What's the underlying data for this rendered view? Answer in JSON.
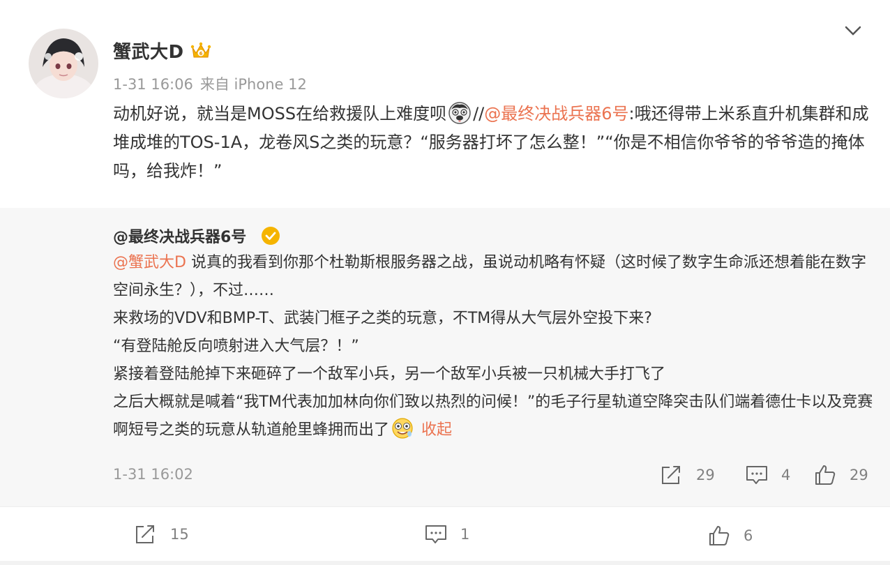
{
  "post": {
    "author": "蟹武大D",
    "time": "1-31 16:06",
    "source": "来自 iPhone 12",
    "text_1": "动机好说，就当是MOSS在给救援队上难度呗",
    "text_sep": "//",
    "mention": "@最终决战兵器6号",
    "text_2": ":哦还得带上米系直升机集群和成堆成堆的TOS-1A，龙卷风S之类的玩意？“服务器打坏了怎么整！”“你是不相信你爷爷的爷爷造的掩体吗，给我炸！”"
  },
  "repost": {
    "author": "@最终决战兵器6号",
    "mention": "@蟹武大D",
    "line_1_rest": " 说真的我看到你那个杜勒斯根服务器之战，虽说动机略有怀疑（这时候了数字生命派还想着能在数字空间永生？），不过……",
    "line_2": "来救场的VDV和BMP-T、武装门框子之类的玩意，不TM得从大气层外空投下来?",
    "line_3": "“有登陆舱反向喷射进入大气层？！”",
    "line_4": "紧接着登陆舱掉下来砸碎了一个敌军小兵，另一个敌军小兵被一只机械大手打飞了",
    "line_5": "之后大概就是喊着“我TM代表加加林向你们致以热烈的问候！”的毛子行星轨道空降突击队们端着德仕卡以及竞赛啊短号之类的玩意从轨道舱里蜂拥而出了",
    "collapse": "收起",
    "time": "1-31 16:02",
    "reposts": "29",
    "comments": "4",
    "likes": "29"
  },
  "footer": {
    "reposts": "15",
    "comments": "1",
    "likes": "6"
  },
  "colors": {
    "mention": "#eb7350",
    "meta": "#999999",
    "repost_bg": "#f7f7f7",
    "verified": "#f5b400"
  },
  "icons": [
    "avatar",
    "crown-icon",
    "chevron-down-icon",
    "emoji-doge-icon",
    "verified-icon",
    "emoji-laugh-icon",
    "share-icon",
    "comment-icon",
    "like-icon"
  ]
}
